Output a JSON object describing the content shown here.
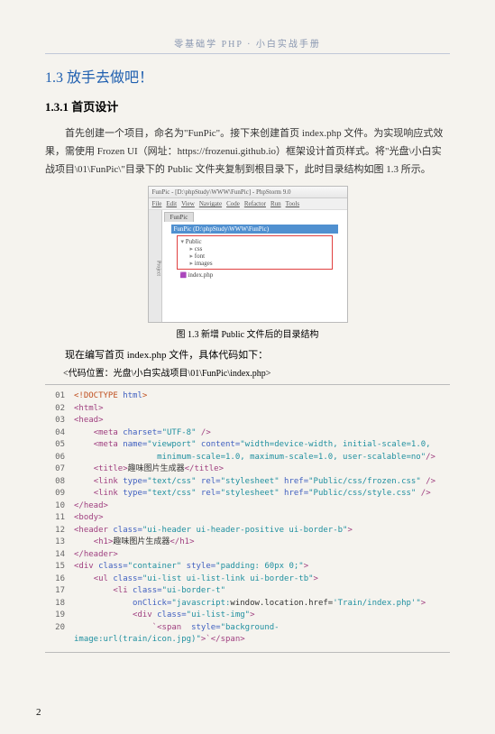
{
  "header": "零基础学 PHP · 小白实战手册",
  "h2": "1.3  放手去做吧！",
  "h3": "1.3.1  首页设计",
  "para": "首先创建一个项目，命名为\"FunPic\"。接下来创建首页 index.php 文件。为实现响应式效果，需使用 Frozen UI（网址：https://frozenui.github.io）框架设计首页样式。将\"光盘\\小白实战项目\\01\\FunPic\\\"目录下的 Public 文件夹复制到根目录下，此时目录结构如图 1.3 所示。",
  "ss": {
    "title": "FunPic - [D:\\phpStudy\\WWW\\FunPic] - PhpStorm 9.0",
    "menu": [
      "File",
      "Edit",
      "View",
      "Navigate",
      "Code",
      "Refactor",
      "Run",
      "Tools"
    ],
    "tab": "FunPic",
    "sel": "FunPic (D:\\phpStudy\\WWW\\FunPic)",
    "folders": [
      "Public",
      "css",
      "font",
      "images"
    ],
    "file": "index.php"
  },
  "caption": "图 1.3  新增 Public 文件后的目录结构",
  "instr": "现在编写首页 index.php 文件，具体代码如下：",
  "path": "<代码位置：光盘\\小白实战项目\\01\\FunPic\\index.php>",
  "code": [
    {
      "n": "01",
      "h": "<span class='s'>&lt;!DOCTYPE</span> <span class='a'>html</span><span class='s'>&gt;</span>"
    },
    {
      "n": "02",
      "h": "<span class='t'>&lt;html&gt;</span>"
    },
    {
      "n": "03",
      "h": "<span class='t'>&lt;head&gt;</span>"
    },
    {
      "n": "04",
      "h": "&nbsp;&nbsp;&nbsp;&nbsp;<span class='t'>&lt;meta</span> <span class='a'>charset=</span><span class='v'>\"UTF-8\"</span> <span class='t'>/&gt;</span>"
    },
    {
      "n": "05",
      "h": "&nbsp;&nbsp;&nbsp;&nbsp;<span class='t'>&lt;meta</span> <span class='a'>name=</span><span class='v'>\"viewport\"</span> <span class='a'>content=</span><span class='v'>\"width=device-width, initial-scale=1.0,</span>"
    },
    {
      "n": "06",
      "h": "&nbsp;&nbsp;&nbsp;&nbsp;&nbsp;&nbsp;&nbsp;&nbsp;&nbsp;&nbsp;&nbsp;&nbsp;&nbsp;&nbsp;&nbsp;&nbsp;&nbsp;<span class='v'>minimum-scale=1.0, maximum-scale=1.0, user-scalable=no\"</span><span class='t'>/&gt;</span>"
    },
    {
      "n": "07",
      "h": "&nbsp;&nbsp;&nbsp;&nbsp;<span class='t'>&lt;title&gt;</span>趣味图片生成器<span class='t'>&lt;/title&gt;</span>"
    },
    {
      "n": "08",
      "h": "&nbsp;&nbsp;&nbsp;&nbsp;<span class='t'>&lt;link</span> <span class='a'>type=</span><span class='v'>\"text/css\"</span> <span class='a'>rel=</span><span class='v'>\"stylesheet\"</span> <span class='a'>href=</span><span class='v'>\"Public/css/frozen.css\"</span> <span class='t'>/&gt;</span>"
    },
    {
      "n": "09",
      "h": "&nbsp;&nbsp;&nbsp;&nbsp;<span class='t'>&lt;link</span> <span class='a'>type=</span><span class='v'>\"text/css\"</span> <span class='a'>rel=</span><span class='v'>\"stylesheet\"</span> <span class='a'>href=</span><span class='v'>\"Public/css/style.css\"</span> <span class='t'>/&gt;</span>"
    },
    {
      "n": "10",
      "h": "<span class='t'>&lt;/head&gt;</span>"
    },
    {
      "n": "11",
      "h": "<span class='t'>&lt;body&gt;</span>"
    },
    {
      "n": "12",
      "h": "<span class='t'>&lt;header</span> <span class='a'>class=</span><span class='v'>\"ui-header ui-header-positive ui-border-b\"</span><span class='t'>&gt;</span>"
    },
    {
      "n": "13",
      "h": "&nbsp;&nbsp;&nbsp;&nbsp;<span class='t'>&lt;h1&gt;</span>趣味图片生成器<span class='t'>&lt;/h1&gt;</span>"
    },
    {
      "n": "14",
      "h": "<span class='t'>&lt;/header&gt;</span>"
    },
    {
      "n": "15",
      "h": "<span class='t'>&lt;div</span> <span class='a'>class=</span><span class='v'>\"container\"</span> <span class='a'>style=</span><span class='v'>\"padding: 60px 0;\"</span><span class='t'>&gt;</span>"
    },
    {
      "n": "16",
      "h": "&nbsp;&nbsp;&nbsp;&nbsp;<span class='t'>&lt;ul</span> <span class='a'>class=</span><span class='v'>\"ui-list ui-list-link ui-border-tb\"</span><span class='t'>&gt;</span>"
    },
    {
      "n": "17",
      "h": "&nbsp;&nbsp;&nbsp;&nbsp;&nbsp;&nbsp;&nbsp;&nbsp;<span class='t'>&lt;li</span> <span class='a'>class=</span><span class='v'>\"ui-border-t\"</span>"
    },
    {
      "n": "18",
      "h": "&nbsp;&nbsp;&nbsp;&nbsp;&nbsp;&nbsp;&nbsp;&nbsp;&nbsp;&nbsp;&nbsp;&nbsp;<span class='a'>onClick=</span><span class='v'>\"javascript:</span>window.location.href=<span class='v'>'Train/index.php'\"</span><span class='t'>&gt;</span>"
    },
    {
      "n": "19",
      "h": "&nbsp;&nbsp;&nbsp;&nbsp;&nbsp;&nbsp;&nbsp;&nbsp;&nbsp;&nbsp;&nbsp;&nbsp;<span class='t'>&lt;div</span> <span class='a'>class=</span><span class='v'>\"ui-list-img\"</span><span class='t'>&gt;</span>"
    },
    {
      "n": "20",
      "h": "&nbsp;&nbsp;&nbsp;&nbsp;&nbsp;&nbsp;&nbsp;&nbsp;&nbsp;&nbsp;&nbsp;&nbsp;&nbsp;&nbsp;&nbsp;&nbsp;<span class='t'>`&lt;span</span>&nbsp;&nbsp;<span class='a'>style=</span><span class='v'>\"background-image:url(train/icon.jpg)\"</span><span class='t'>&gt;`&lt;/span&gt;</span>"
    }
  ],
  "pagenum": "2"
}
